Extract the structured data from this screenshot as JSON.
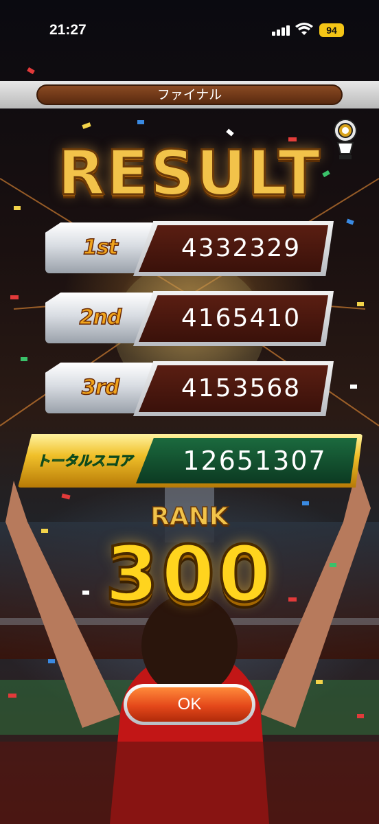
{
  "status_bar": {
    "time": "21:27",
    "battery": "94"
  },
  "header": {
    "stage_label": "ファイナル"
  },
  "title": "RESULT",
  "scores": [
    {
      "rank": "1st",
      "value": "4332329"
    },
    {
      "rank": "2nd",
      "value": "4165410"
    },
    {
      "rank": "3rd",
      "value": "4153568"
    }
  ],
  "total": {
    "label": "トータルスコア",
    "value": "12651307"
  },
  "rank": {
    "heading": "RANK",
    "number": "300"
  },
  "ok_button": {
    "label": "OK"
  },
  "icons": {
    "signal": "cellular-signal-icon",
    "wifi": "wifi-icon",
    "battery": "battery-icon",
    "trophy": "trophy-badge-icon"
  }
}
